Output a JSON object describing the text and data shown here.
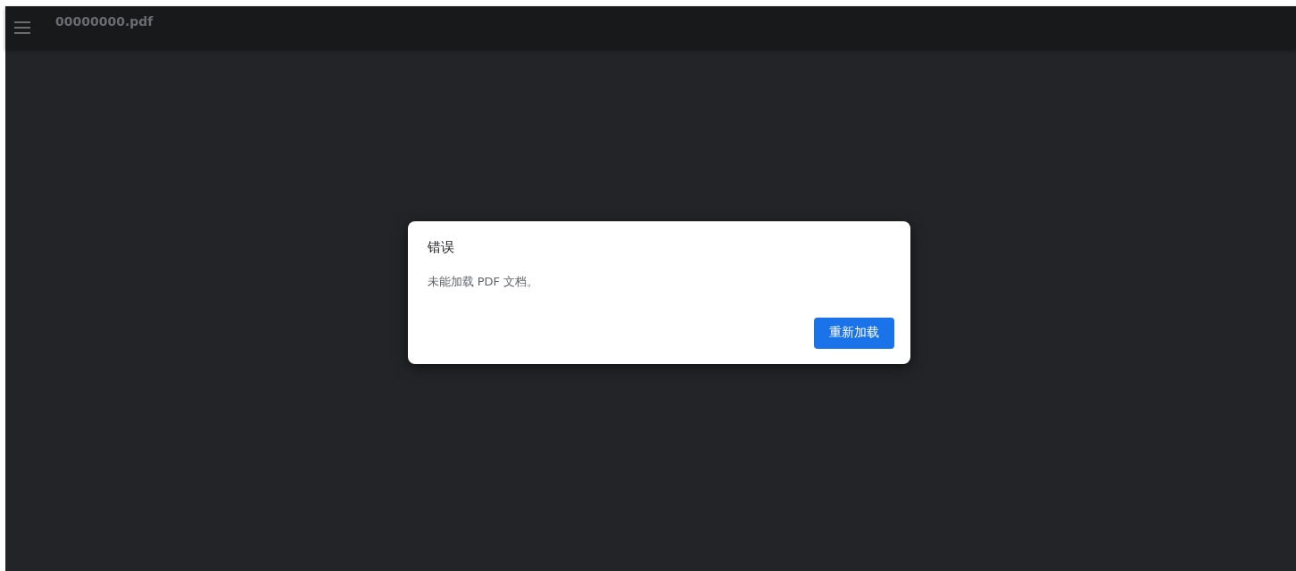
{
  "toolbar": {
    "title": "00000000.pdf"
  },
  "dialog": {
    "title": "错误",
    "message": "未能加载 PDF 文档。",
    "button": "重新加载"
  }
}
